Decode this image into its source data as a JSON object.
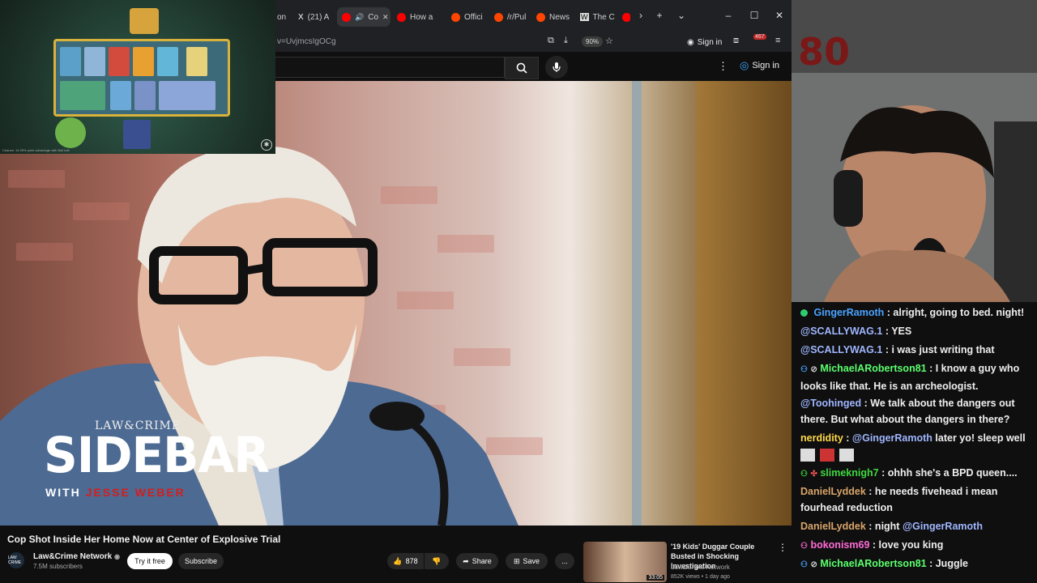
{
  "browser": {
    "tabs": [
      {
        "label": "on",
        "fav_color": "#777"
      },
      {
        "label": "(21) A",
        "fav_color": "#ffffff",
        "icon": "x-logo"
      },
      {
        "label": "Co",
        "fav_color": "#ff0000",
        "active": true
      },
      {
        "label": "How a",
        "fav_color": "#ff0000"
      },
      {
        "label": "Offici",
        "fav_color": "#ff4500"
      },
      {
        "label": "/r/Pul",
        "fav_color": "#ff4500"
      },
      {
        "label": "News",
        "fav_color": "#ff4500"
      },
      {
        "label": "The C",
        "fav_color": "#dddddd",
        "icon": "wikipedia-w"
      }
    ],
    "url": "v=UvjmcsIgOCg",
    "zoom": "90%",
    "sign_in": "Sign in",
    "ext_badge": "467"
  },
  "youtube": {
    "header_sign_in": "Sign in"
  },
  "game_overlay": {
    "footer_text": "Chance: 14.09% point advantage with Bull ball"
  },
  "video": {
    "brand_top": "LAW&CRIME",
    "brand_main": "SIDEBAR",
    "brand_with": "WITH",
    "brand_host": "JESSE WEBER",
    "title": "Cop Shot Inside Her Home Now at Center of Explosive Trial",
    "channel": "Law&Crime Network",
    "channel_avatar_text": "LAW CRIME",
    "subscribers": "7.5M subscribers",
    "try_free": "Try it free",
    "subscribe": "Subscribe",
    "likes": "878",
    "share": "Share",
    "save": "Save",
    "more": "..."
  },
  "recommended": {
    "title": "'19 Kids' Duggar Couple Busted in Shocking Investigation",
    "channel": "Law&Crime Network",
    "meta": "852K views • 1 day ago",
    "duration": "33:05"
  },
  "chat": [
    {
      "user": "GingerRamoth",
      "color": "#4aa3ff",
      "text": ": alright, going to bed. night!",
      "badge": "check"
    },
    {
      "user": "@SCALLYWAG.1",
      "color": "#9fb6ff",
      "text": ": YES"
    },
    {
      "user": "@SCALLYWAG.1",
      "color": "#9fb6ff",
      "text": ": i was just writing that"
    },
    {
      "user": "MichaelARobertson81",
      "color": "#5bff6e",
      "text": ": I know a guy who looks like that. He is an archeologist.",
      "badge": "user"
    },
    {
      "user": "@Toohinged",
      "color": "#9fb6ff",
      "text": ": We talk about the dangers out there. But what about the dangers in there?"
    },
    {
      "user": "nerdidity",
      "color": "#ffd84a",
      "text": ": ",
      "mention": "@GingerRamoth",
      "after": " later yo! sleep well"
    },
    {
      "user": "slimeknigh7",
      "color": "#3fd83f",
      "text": ": ohhh she's a BPD queen....",
      "badge": "user"
    },
    {
      "user": "DanielLyddek",
      "color": "#d8a46a",
      "text": ": he needs fivehead i mean fourhead reduction"
    },
    {
      "user": "DanielLyddek",
      "color": "#d8a46a",
      "text": ": night ",
      "mention": "@GingerRamoth"
    },
    {
      "user": "bokonism69",
      "color": "#ff6bd6",
      "text": ": love you king",
      "badge": "user"
    },
    {
      "user": "MichaelARobertson81",
      "color": "#5bff6e",
      "text": ": Juggle",
      "badge": "user"
    }
  ]
}
